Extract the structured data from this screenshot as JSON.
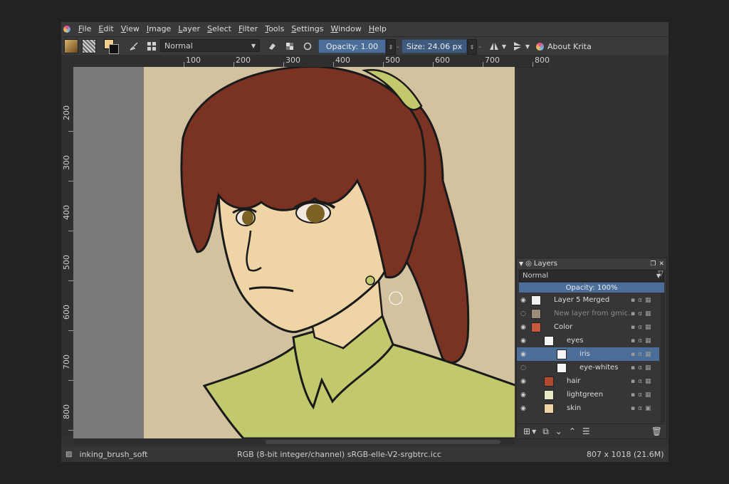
{
  "menu": {
    "items": [
      "File",
      "Edit",
      "View",
      "Image",
      "Layer",
      "Select",
      "Filter",
      "Tools",
      "Settings",
      "Window",
      "Help"
    ]
  },
  "toolbar": {
    "blend_mode": "Normal",
    "opacity_label": "Opacity: 1.00",
    "size_label": "Size: 24.06 px",
    "about_label": "About Krita"
  },
  "rulers": {
    "horizontal": [
      "100",
      "200",
      "300",
      "400",
      "500",
      "600",
      "700",
      "800"
    ],
    "vertical": [
      "200",
      "300",
      "400",
      "500",
      "600",
      "700",
      "800"
    ]
  },
  "layers_panel": {
    "title": "Layers",
    "blend_mode": "Normal",
    "opacity_label": "Opacity:  100%",
    "layers": [
      {
        "name": "Layer 5 Merged",
        "indent": 0,
        "selected": false,
        "dim": false
      },
      {
        "name": "New layer from gmic...",
        "indent": 0,
        "selected": false,
        "dim": true
      },
      {
        "name": "Color",
        "indent": 0,
        "selected": false,
        "dim": false
      },
      {
        "name": "eyes",
        "indent": 1,
        "selected": false,
        "dim": false
      },
      {
        "name": "iris",
        "indent": 2,
        "selected": true,
        "dim": false
      },
      {
        "name": "eye-whites",
        "indent": 2,
        "selected": false,
        "dim": false
      },
      {
        "name": "hair",
        "indent": 1,
        "selected": false,
        "dim": false
      },
      {
        "name": "lightgreen",
        "indent": 1,
        "selected": false,
        "dim": false
      },
      {
        "name": "skin",
        "indent": 1,
        "selected": false,
        "dim": false
      }
    ]
  },
  "status": {
    "brush": "inking_brush_soft",
    "color_info": "RGB (8-bit integer/channel)  sRGB-elle-V2-srgbtrc.icc",
    "dimensions": "807 x 1018 (21.6M)"
  },
  "colors": {
    "accent": "#4b6d97",
    "hair": "#7a3322",
    "skin": "#efd4a6",
    "shirt": "#c2c96c",
    "background": "#d3c2a0"
  }
}
